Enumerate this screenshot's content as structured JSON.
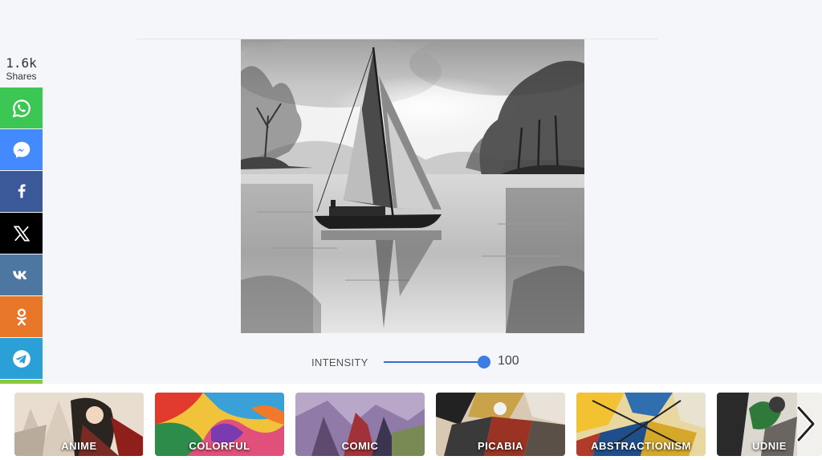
{
  "share": {
    "count": "1.6k",
    "label": "Shares",
    "buttons": [
      {
        "name": "whatsapp",
        "color": "#3cc653"
      },
      {
        "name": "messenger",
        "color": "#448aff"
      },
      {
        "name": "facebook",
        "color": "#3b5998"
      },
      {
        "name": "x",
        "color": "#000000"
      },
      {
        "name": "vk",
        "color": "#4d76a1"
      },
      {
        "name": "odnoklassniki",
        "color": "#e8772a"
      },
      {
        "name": "telegram",
        "color": "#2aa0d6"
      },
      {
        "name": "share",
        "color": "#8dc63f"
      }
    ]
  },
  "editor": {
    "intensity_label": "INTENSITY",
    "intensity_value": "100",
    "intensity_fraction": 1.0,
    "accent": "#3b7de0"
  },
  "styles": [
    {
      "label": "ANIME"
    },
    {
      "label": "COLORFUL"
    },
    {
      "label": "COMIC"
    },
    {
      "label": "PICABIA"
    },
    {
      "label": "ABSTRACTIONISM"
    },
    {
      "label": "UDNIE"
    }
  ],
  "icons": {
    "next": "chevron-right-icon"
  }
}
